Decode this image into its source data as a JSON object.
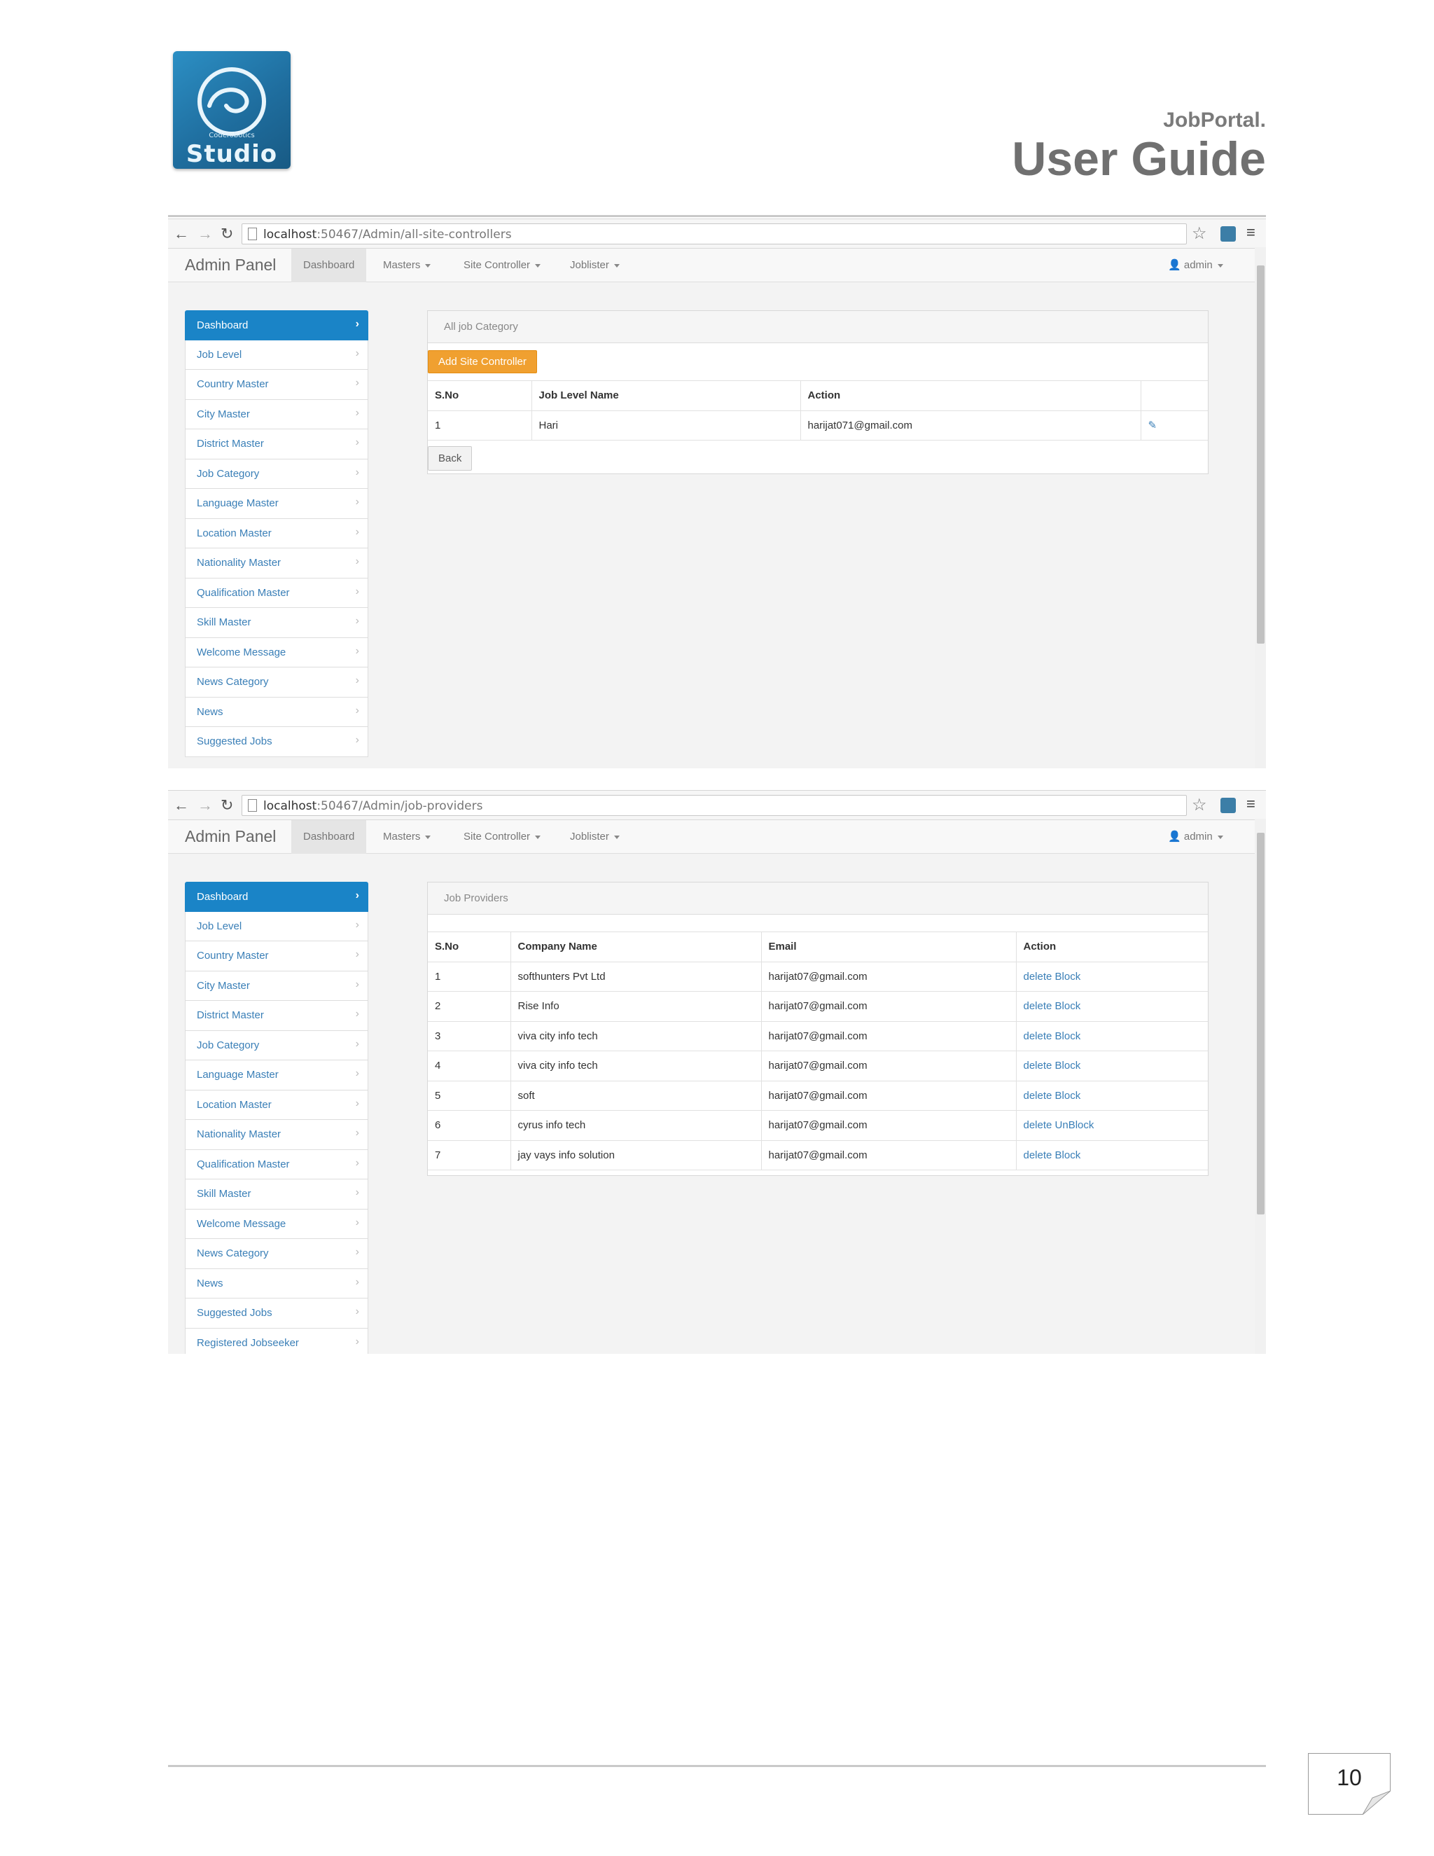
{
  "header": {
    "logo_small": "Coderobotics",
    "logo_big": "Studio",
    "product": "JobPortal.",
    "title": "User Guide"
  },
  "sidebar_items": [
    "Dashboard",
    "Job Level",
    "Country Master",
    "City Master",
    "District Master",
    "Job Category",
    "Language Master",
    "Location Master",
    "Nationality Master",
    "Qualification Master",
    "Skill Master",
    "Welcome Message",
    "News Category",
    "News",
    "Suggested Jobs",
    "Registered Jobseeker"
  ],
  "topnav": {
    "app_title": "Admin Panel",
    "tabs": [
      "Dashboard",
      "Masters",
      "Site Controller",
      "Joblister"
    ],
    "user": "admin"
  },
  "screenshot1": {
    "url_host": "localhost",
    "url_rest": ":50467/Admin/all-site-controllers",
    "panel_title": "All job Category",
    "add_button": "Add Site Controller",
    "columns": [
      "S.No",
      "Job Level Name",
      "Action"
    ],
    "row": {
      "sno": "1",
      "name": "Hari",
      "action": "harijat071@gmail.com"
    },
    "back_button": "Back"
  },
  "screenshot2": {
    "url_host": "localhost",
    "url_rest": ":50467/Admin/job-providers",
    "panel_title": "Job Providers",
    "columns": [
      "S.No",
      "Company Name",
      "Email",
      "Action"
    ],
    "rows": [
      {
        "sno": "1",
        "company": "softhunters Pvt Ltd",
        "email": "harijat07@gmail.com",
        "del": "delete",
        "act": "Block"
      },
      {
        "sno": "2",
        "company": "Rise Info",
        "email": "harijat07@gmail.com",
        "del": "delete",
        "act": "Block"
      },
      {
        "sno": "3",
        "company": "viva city info tech",
        "email": "harijat07@gmail.com",
        "del": "delete",
        "act": "Block"
      },
      {
        "sno": "4",
        "company": "viva city info tech",
        "email": "harijat07@gmail.com",
        "del": "delete",
        "act": "Block"
      },
      {
        "sno": "5",
        "company": "soft",
        "email": "harijat07@gmail.com",
        "del": "delete",
        "act": "Block"
      },
      {
        "sno": "6",
        "company": "cyrus info tech",
        "email": "harijat07@gmail.com",
        "del": "delete",
        "act": "UnBlock"
      },
      {
        "sno": "7",
        "company": "jay vays info solution",
        "email": "harijat07@gmail.com",
        "del": "delete",
        "act": "Block"
      }
    ]
  },
  "footer": {
    "page_number": "10"
  },
  "colors": {
    "accent": "#1a84c7",
    "orange": "#f0a030",
    "link": "#3a7fb7"
  }
}
